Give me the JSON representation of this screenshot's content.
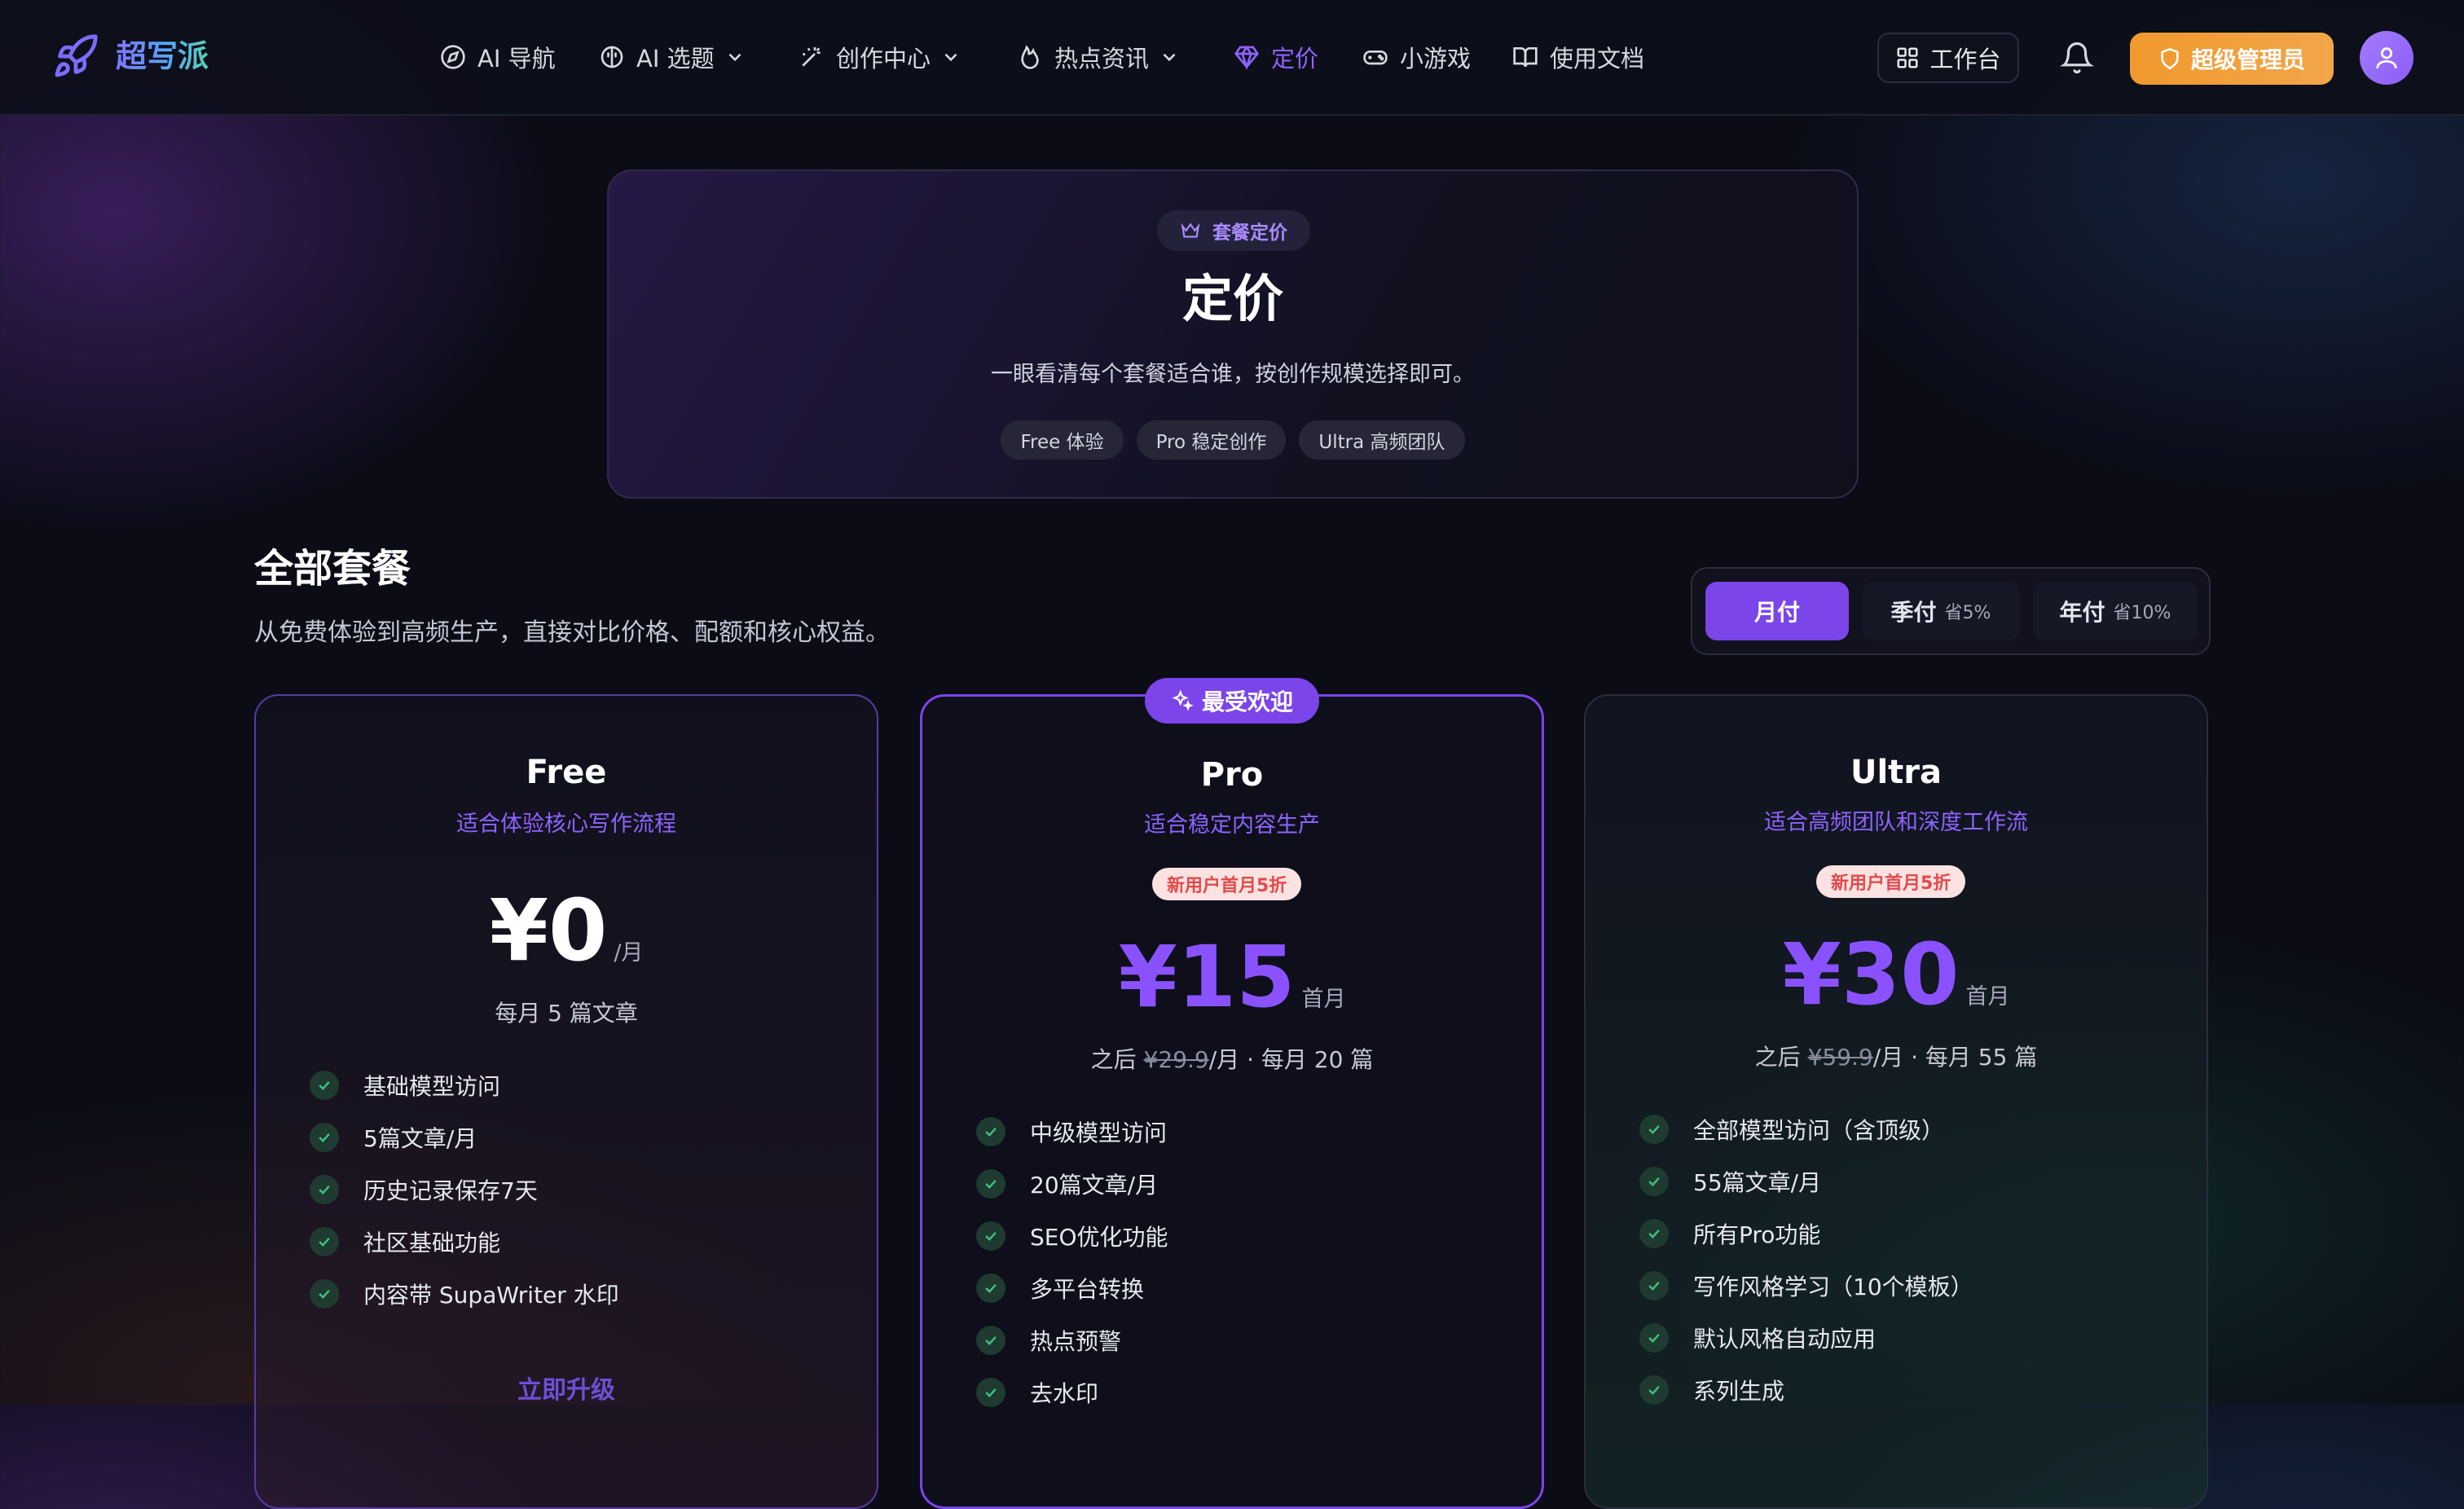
{
  "brand": {
    "name": "超写派"
  },
  "nav": {
    "items": [
      {
        "label": "AI 导航"
      },
      {
        "label": "AI 选题"
      },
      {
        "label": "创作中心"
      },
      {
        "label": "热点资讯"
      },
      {
        "label": "定价"
      },
      {
        "label": "小游戏"
      },
      {
        "label": "使用文档"
      }
    ],
    "workbench": "工作台",
    "admin": "超级管理员"
  },
  "hero": {
    "badge": "套餐定价",
    "title": "定价",
    "subtitle": "一眼看清每个套餐适合谁，按创作规模选择即可。",
    "chips": [
      "Free 体验",
      "Pro 稳定创作",
      "Ultra 高频团队"
    ]
  },
  "plans_section": {
    "title": "全部套餐",
    "subtitle": "从免费体验到高频生产，直接对比价格、配额和核心权益。",
    "billing": [
      {
        "label": "月付",
        "save": ""
      },
      {
        "label": "季付",
        "save": "省5%"
      },
      {
        "label": "年付",
        "save": "省10%"
      }
    ]
  },
  "plans": {
    "free": {
      "name": "Free",
      "tagline": "适合体验核心写作流程",
      "price": "¥0",
      "unit": "/月",
      "note": "每月 5 篇文章",
      "features": [
        "基础模型访问",
        "5篇文章/月",
        "历史记录保存7天",
        "社区基础功能",
        "内容带 SupaWriter 水印"
      ],
      "cta": "立即升级"
    },
    "pro": {
      "badge": "最受欢迎",
      "name": "Pro",
      "tagline": "适合稳定内容生产",
      "promo": "新用户首月5折",
      "price": "¥15",
      "unit": "首月",
      "note_prefix": "之后 ",
      "note_old": "¥29.9",
      "note_suffix": "/月 · 每月 20 篇",
      "features": [
        "中级模型访问",
        "20篇文章/月",
        "SEO优化功能",
        "多平台转换",
        "热点预警",
        "去水印"
      ]
    },
    "ultra": {
      "name": "Ultra",
      "tagline": "适合高频团队和深度工作流",
      "promo": "新用户首月5折",
      "price": "¥30",
      "unit": "首月",
      "note_prefix": "之后 ",
      "note_old": "¥59.9",
      "note_suffix": "/月 · 每月 55 篇",
      "features": [
        "全部模型访问（含顶级）",
        "55篇文章/月",
        "所有Pro功能",
        "写作风格学习（10个模板）",
        "默认风格自动应用",
        "系列生成"
      ]
    }
  },
  "colors": {
    "accent": "#8e63ff",
    "admin": "#f0992e",
    "check": "#3fbf7f"
  }
}
